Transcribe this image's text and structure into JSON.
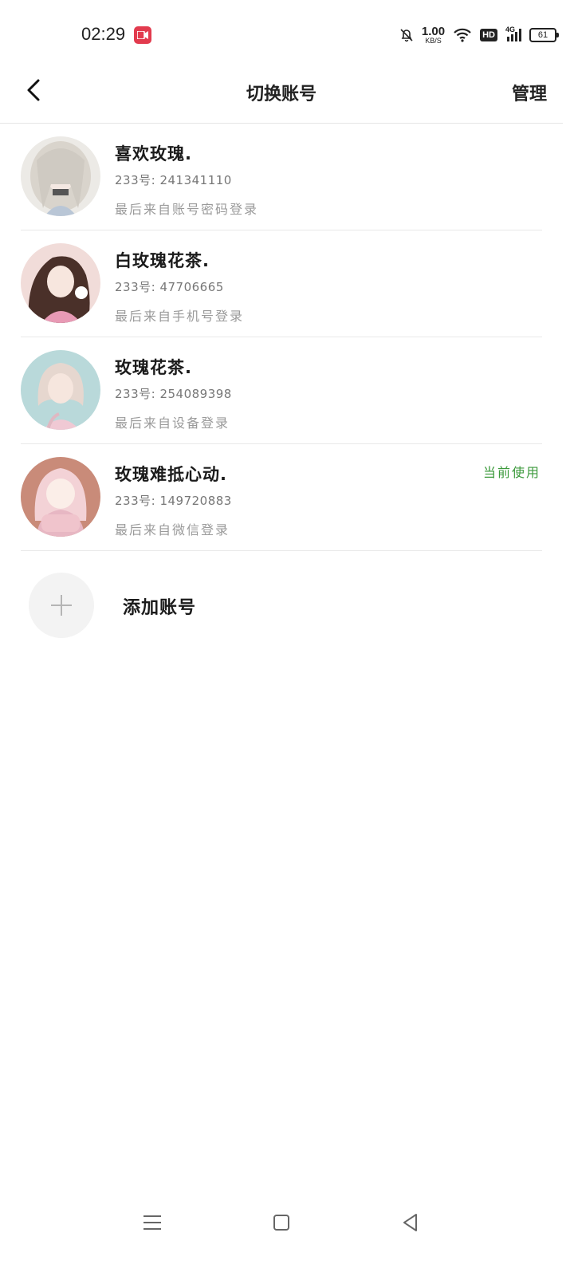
{
  "status_bar": {
    "time": "02:29",
    "net_speed_value": "1.00",
    "net_speed_unit": "KB/S",
    "hd": "HD",
    "signal_type": "4G",
    "battery": "61",
    "icons": [
      "screen-record-icon",
      "mute-bell-icon",
      "wifi-icon",
      "signal-icon",
      "battery-icon"
    ]
  },
  "header": {
    "title": "切换账号",
    "manage": "管理"
  },
  "accounts": [
    {
      "name": "喜欢玫瑰.",
      "uid": "233号: 241341110",
      "login": "最后来自账号密码登录",
      "status": ""
    },
    {
      "name": "白玫瑰花茶.",
      "uid": "233号: 47706665",
      "login": "最后来自手机号登录",
      "status": ""
    },
    {
      "name": "玫瑰花茶.",
      "uid": "233号: 254089398",
      "login": "最后来自设备登录",
      "status": ""
    },
    {
      "name": "玫瑰难抵心动.",
      "uid": "233号: 149720883",
      "login": "最后来自微信登录",
      "status": "当前使用"
    }
  ],
  "add_account": {
    "label": "添加账号"
  },
  "colors": {
    "current_status": "#3c9a3c",
    "record_badge": "#e23b4e",
    "divider": "#e9e9e9"
  },
  "nav_bar": {
    "icons": [
      "menu-icon",
      "home-icon",
      "back-triangle-icon"
    ]
  }
}
